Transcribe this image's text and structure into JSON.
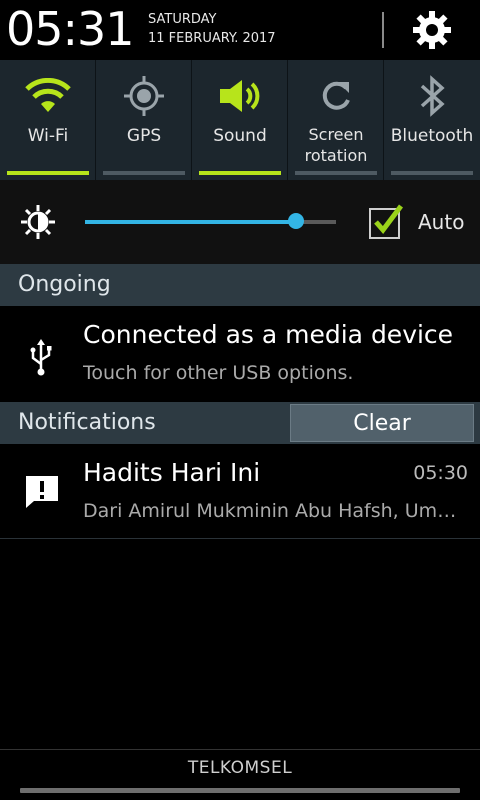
{
  "header": {
    "time": "05:31",
    "day": "SATURDAY",
    "date": "11 FEBRUARY. 2017"
  },
  "quick_settings": [
    {
      "label": "Wi-Fi",
      "icon": "wifi-icon",
      "active": true
    },
    {
      "label": "GPS",
      "icon": "gps-icon",
      "active": false
    },
    {
      "label": "Sound",
      "icon": "speaker-icon",
      "active": true
    },
    {
      "label": "Screen rotation",
      "icon": "rotation-icon",
      "active": false
    },
    {
      "label": "Bluetooth",
      "icon": "bluetooth-icon",
      "active": false
    }
  ],
  "brightness": {
    "level": 0.84,
    "auto_label": "Auto",
    "auto_checked": true
  },
  "ongoing": {
    "header": "Ongoing",
    "title": "Connected as a media device",
    "subtitle": "Touch for other USB options."
  },
  "notifications": {
    "header": "Notifications",
    "clear_label": "Clear",
    "items": [
      {
        "title": "Hadits Hari Ini",
        "time": "05:30",
        "subtitle": "Dari Amirul Mukminin Abu Hafsh, Umar bin Khattab"
      }
    ]
  },
  "footer": {
    "carrier": "TELKOMSEL"
  },
  "colors": {
    "accent_green": "#b7e41b",
    "slider_blue": "#33b5e5",
    "panel_dark": "#1c262d",
    "section_header": "#2d3a42"
  }
}
